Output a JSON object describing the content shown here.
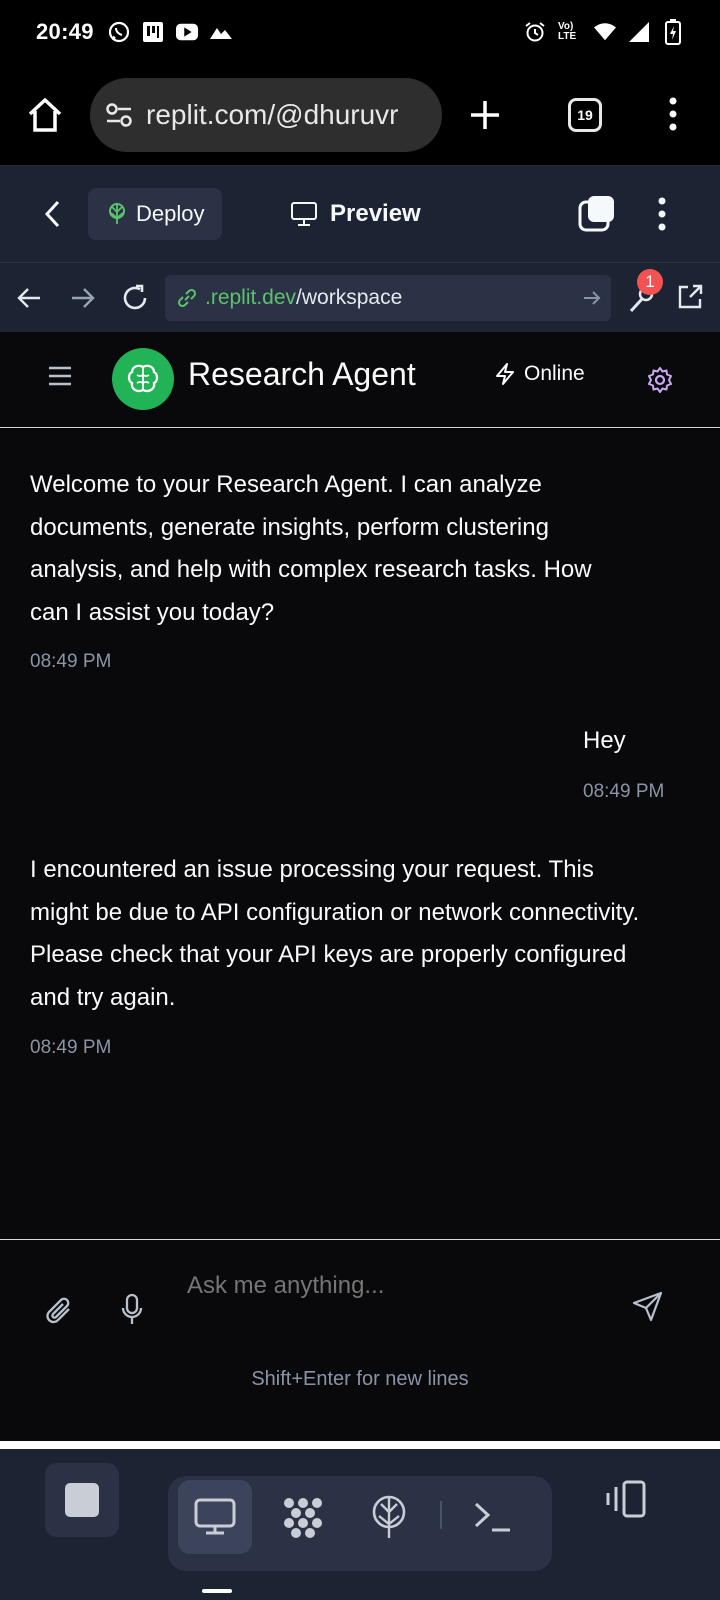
{
  "status_bar": {
    "time": "20:49",
    "network_label": "Vo) LTE"
  },
  "browser": {
    "url": "replit.com/@dhuruvr",
    "tab_count": "19"
  },
  "replit_header": {
    "deploy_label": "Deploy",
    "preview_label": "Preview"
  },
  "replit_nav": {
    "url_host": ".replit.dev",
    "url_path": "/workspace",
    "badge_count": "1"
  },
  "app": {
    "title": "Research Agent",
    "status": "Online"
  },
  "messages": [
    {
      "role": "assistant",
      "text": "Welcome to your Research Agent. I can analyze documents, generate insights, perform clustering analysis, and help with complex research tasks. How can I assist you today?",
      "time": "08:49 PM"
    },
    {
      "role": "user",
      "text": "Hey",
      "time": "08:49 PM"
    },
    {
      "role": "assistant",
      "text": "I encountered an issue processing your request. This might be due to API configuration or network connectivity. Please check that your API keys are properly configured and try again.",
      "time": "08:49 PM"
    }
  ],
  "composer": {
    "placeholder": "Ask me anything...",
    "hint": "Shift+Enter for new lines"
  },
  "colors": {
    "replit_bg": "#1c2333",
    "accent_green": "#22b356",
    "badge_red": "#f35252",
    "app_bg": "#09090b",
    "muted_text": "#8a94a6"
  }
}
